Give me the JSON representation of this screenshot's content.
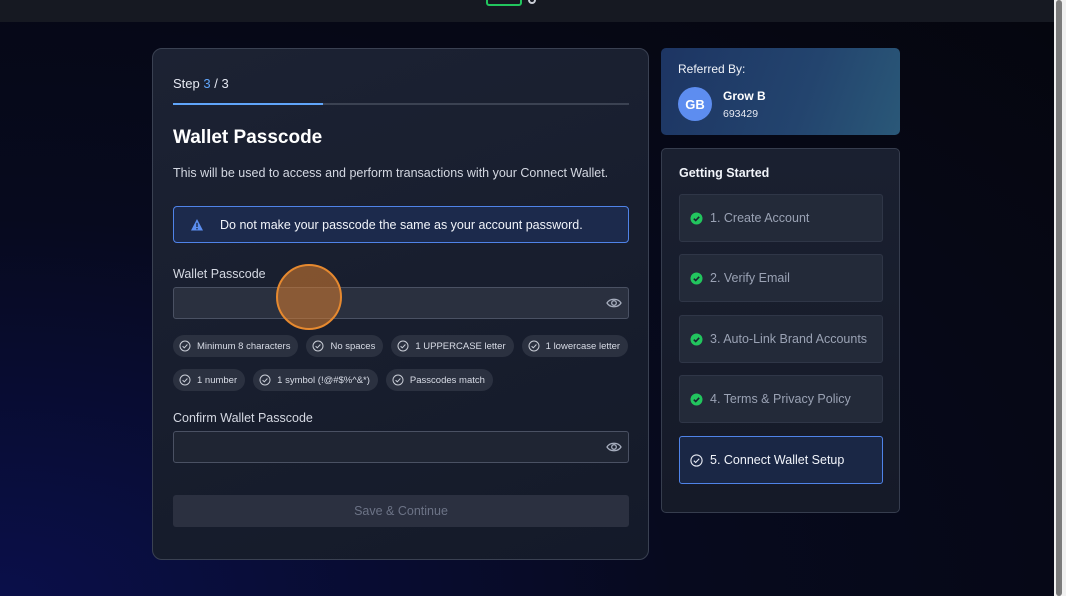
{
  "step": {
    "prefix": "Step",
    "current": "3",
    "separator": "/",
    "total": "3",
    "progress_fraction": 0.33
  },
  "form": {
    "title": "Wallet Passcode",
    "description": "This will be used to access and perform transactions with your Connect Wallet.",
    "alert_text": "Do not make your passcode the same as your account password.",
    "passcode_label": "Wallet Passcode",
    "passcode_value": "",
    "confirm_label": "Confirm Wallet Passcode",
    "confirm_value": "",
    "requirements_row1": [
      "Minimum 8 characters",
      "No spaces",
      "1 UPPERCASE letter",
      "1 lowercase letter"
    ],
    "requirements_row2": [
      "1 number",
      "1 symbol (!@#$%^&*)",
      "Passcodes match"
    ],
    "save_label": "Save & Continue"
  },
  "referral": {
    "title": "Referred By:",
    "initials": "GB",
    "name": "Grow B",
    "code": "693429"
  },
  "getting_started": {
    "title": "Getting Started",
    "items": [
      {
        "label": "1. Create Account",
        "status": "done"
      },
      {
        "label": "2. Verify Email",
        "status": "done"
      },
      {
        "label": "3. Auto-Link Brand Accounts",
        "status": "done"
      },
      {
        "label": "4. Terms & Privacy Policy",
        "status": "done"
      },
      {
        "label": "5. Connect Wallet Setup",
        "status": "current"
      }
    ]
  },
  "colors": {
    "accent": "#60a5fa",
    "success": "#22c55e",
    "alert_border": "#4f83e8",
    "avatar": "#5d8df0"
  }
}
